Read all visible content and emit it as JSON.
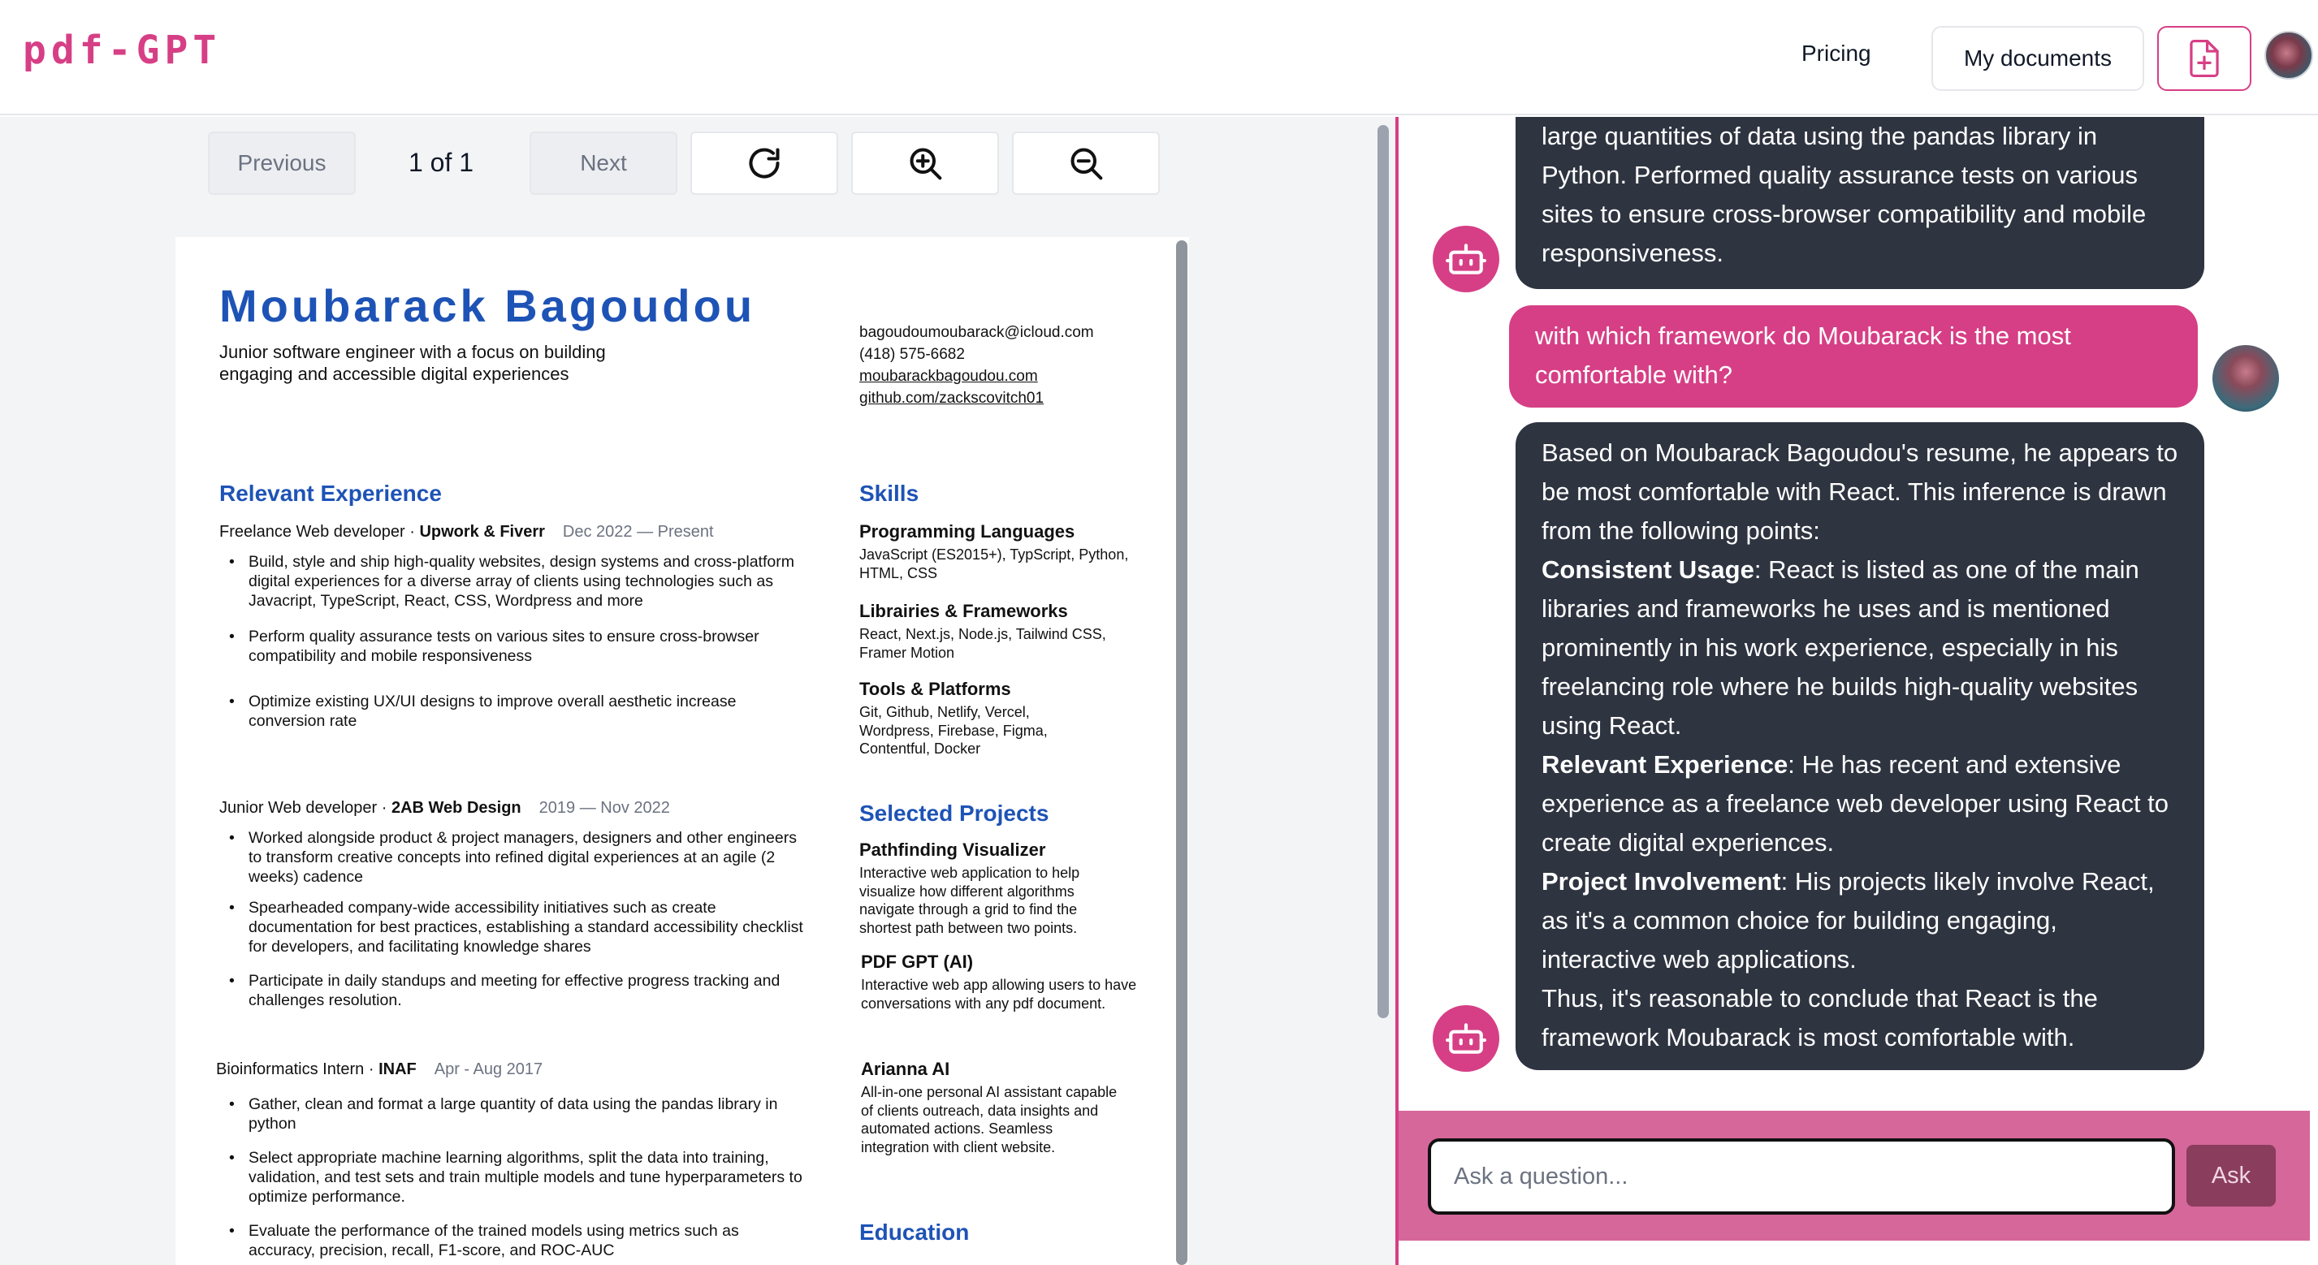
{
  "app": {
    "logo": "pdf-GPT"
  },
  "nav": {
    "pricing": "Pricing",
    "my_documents": "My documents",
    "upload_icon": "file-plus-icon"
  },
  "toolbar": {
    "previous": "Previous",
    "page_indicator": "1 of 1",
    "next": "Next",
    "rotate_icon": "rotate-icon",
    "zoom_in_icon": "zoom-in-icon",
    "zoom_out_icon": "zoom-out-icon"
  },
  "resume": {
    "name": "Moubarack Bagoudou",
    "tagline": "Junior software engineer with a focus on building engaging and accessible digital experiences",
    "contact": {
      "email": "bagoudoumoubarack@icloud.com",
      "phone": "(418) 575-6682",
      "website": "moubarackbagoudou.com",
      "github": "github.com/zackscovitch01"
    },
    "experience_heading": "Relevant Experience",
    "jobs": [
      {
        "title": "Freelance Web developer · ",
        "company": "Upwork & Fiverr",
        "dates": "Dec 2022 — Present",
        "bullets": [
          "Build, style and ship high-quality websites, design systems and cross-platform digital experiences for a diverse array of clients using technologies such as Javacript, TypeScript, React, CSS, Wordpress and more",
          "Perform quality assurance tests on various sites to ensure cross-browser compatibility and mobile responsiveness",
          "Optimize existing UX/UI designs to improve overall aesthetic increase conversion rate"
        ]
      },
      {
        "title": "Junior Web developer · ",
        "company": "2AB Web Design",
        "dates": "2019 — Nov 2022",
        "bullets": [
          "Worked alongside product & project managers, designers and other engineers to transform creative concepts into refined digital experiences at an agile (2 weeks) cadence",
          "Spearheaded company-wide accessibility initiatives such as create documentation for best practices, establishing a standard accessibility checklist for developers, and facilitating knowledge shares",
          "Participate in daily standups and meeting for effective progress tracking and challenges resolution."
        ]
      },
      {
        "title": "Bioinformatics Intern · ",
        "company": "INAF",
        "dates": "Apr - Aug 2017",
        "bullets": [
          "Gather, clean and format a large quantity of data using the pandas library in python",
          "Select appropriate machine learning algorithms, split the data into training, validation, and test sets and train multiple models and tune hyperparameters to optimize performance.",
          "Evaluate the performance of the trained models using metrics such as accuracy, precision, recall, F1-score, and ROC-AUC"
        ]
      }
    ],
    "skills_heading": "Skills",
    "skills": [
      {
        "title": "Programming Languages",
        "text": "JavaScript (ES2015+), TypScript, Python, HTML, CSS"
      },
      {
        "title": "Librairies & Frameworks",
        "text": "React, Next.js, Node.js, Tailwind CSS, Framer Motion"
      },
      {
        "title": "Tools & Platforms",
        "text": "Git, Github, Netlify, Vercel, Wordpress, Firebase, Figma, Contentful, Docker"
      }
    ],
    "projects_heading": "Selected Projects",
    "projects": [
      {
        "title": "Pathfinding Visualizer",
        "text": "Interactive web application to help visualize how different algorithms navigate through a grid to find the shortest path between two points."
      },
      {
        "title": "PDF GPT (AI)",
        "text": "Interactive web app allowing users to have conversations with any pdf document."
      },
      {
        "title": "Arianna AI",
        "text": "All-in-one personal AI assistant capable of clients outreach, data insights and automated actions. Seamless integration with client website."
      }
    ],
    "education_heading": "Education"
  },
  "chat": {
    "messages": [
      {
        "role": "bot",
        "text": "large quantities of data using the pandas library in Python. Performed quality assurance tests on various sites to ensure cross-browser compatibility and mobile responsiveness."
      },
      {
        "role": "user",
        "text": "with which framework do Moubarack is the most comfortable with?"
      },
      {
        "role": "bot",
        "intro": "Based on Moubarack Bagoudou's resume, he appears to be most comfortable with React. This inference is drawn from the following points:",
        "p1_label": "Consistent Usage",
        "p1_text": ": React is listed as one of the main libraries and frameworks he uses and is mentioned prominently in his work experience, especially in his freelancing role where he builds high-quality websites using React.",
        "p2_label": "Relevant Experience",
        "p2_text": ": He has recent and extensive experience as a freelance web developer using React to create digital experiences.",
        "p3_label": "Project Involvement",
        "p3_text": ": His projects likely involve React, as it's a common choice for building engaging, interactive web applications.",
        "conclusion": "Thus, it's reasonable to conclude that React is the framework Moubarack is most comfortable with."
      }
    ],
    "input_placeholder": "Ask a question...",
    "ask_button": "Ask"
  },
  "colors": {
    "brand": "#d63f85",
    "bot_bubble": "#2e3440",
    "resume_blue": "#1e53b6",
    "footer": "#d6679a"
  }
}
